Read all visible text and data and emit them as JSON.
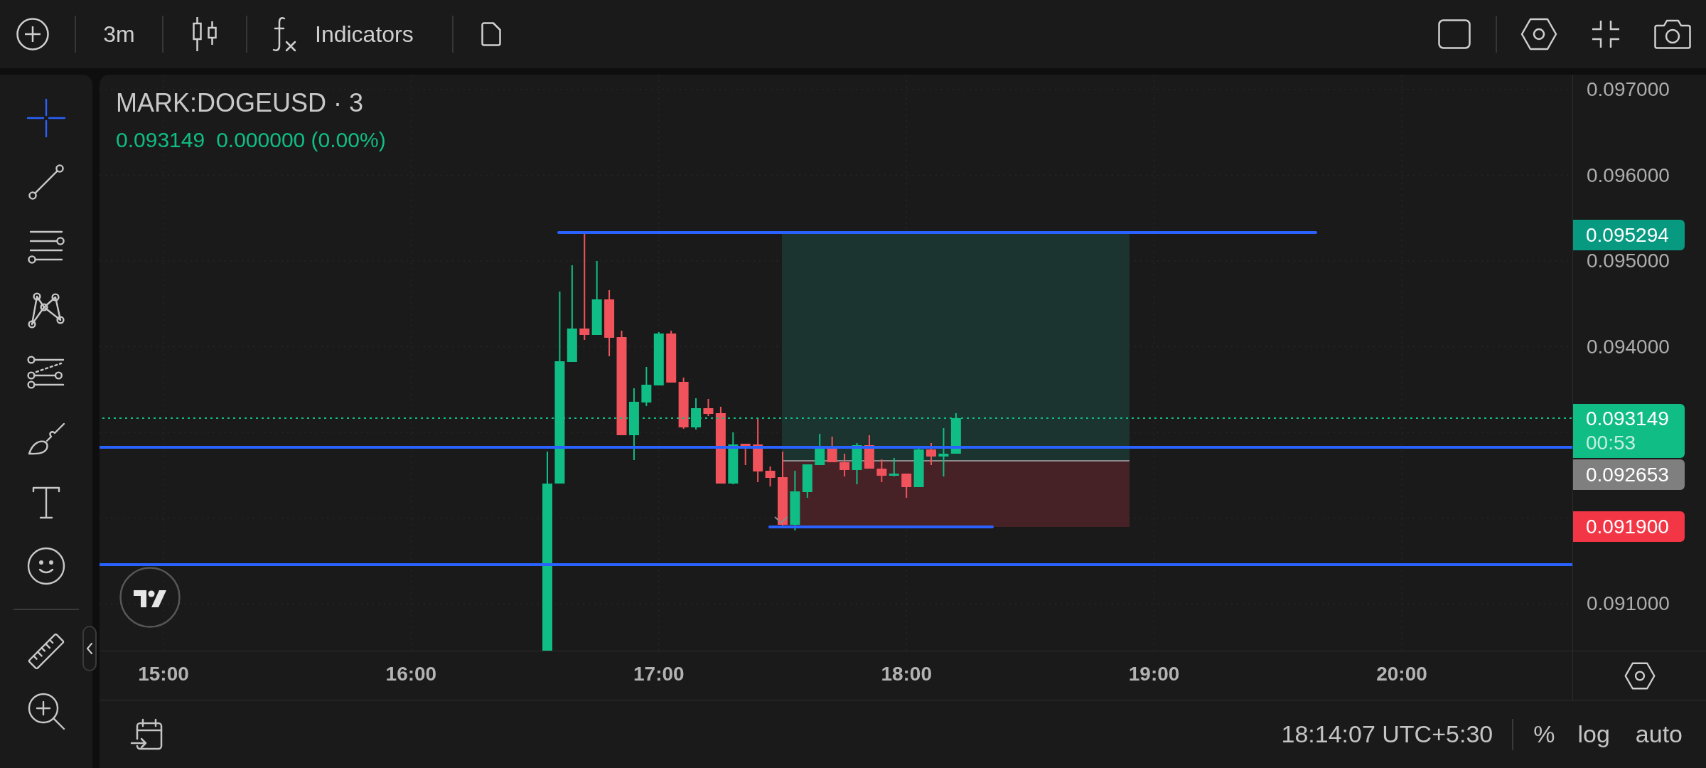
{
  "top_bar": {
    "interval": "3m",
    "indicators": "Indicators"
  },
  "drawing_tools": [
    {
      "selected": true
    },
    {
      "selected": false
    },
    {
      "selected": false
    },
    {
      "selected": false
    },
    {
      "selected": false
    },
    {
      "selected": false
    },
    {
      "selected": false
    },
    {
      "selected": false
    }
  ],
  "measure_tools": [
    {
      "selected": false
    },
    {
      "selected": false
    }
  ],
  "legend": {
    "symbol": "MARK:DOGEUSD · 3",
    "last_price": "0.093149",
    "change": "0.000000 (0.00%)"
  },
  "price_axis": {
    "labels": [
      "0.097000",
      "0.096000",
      "0.095000",
      "0.094000",
      "0.091000"
    ]
  },
  "price_tags": [
    {
      "text": "0.095294",
      "color": "#089981"
    },
    {
      "text": "0.093149",
      "countdown": "00:53",
      "color": "#10bd84"
    },
    {
      "text": "0.092653",
      "color": "#7f7f7f"
    },
    {
      "text": "0.091900",
      "color": "#f23645"
    }
  ],
  "time_axis": {
    "labels": [
      "15:00",
      "16:00",
      "17:00",
      "18:00",
      "19:00",
      "20:00"
    ]
  },
  "status_bar": {
    "time": "18:14:07 UTC+5:30",
    "percent": "%",
    "log": "log",
    "auto": "auto"
  }
}
